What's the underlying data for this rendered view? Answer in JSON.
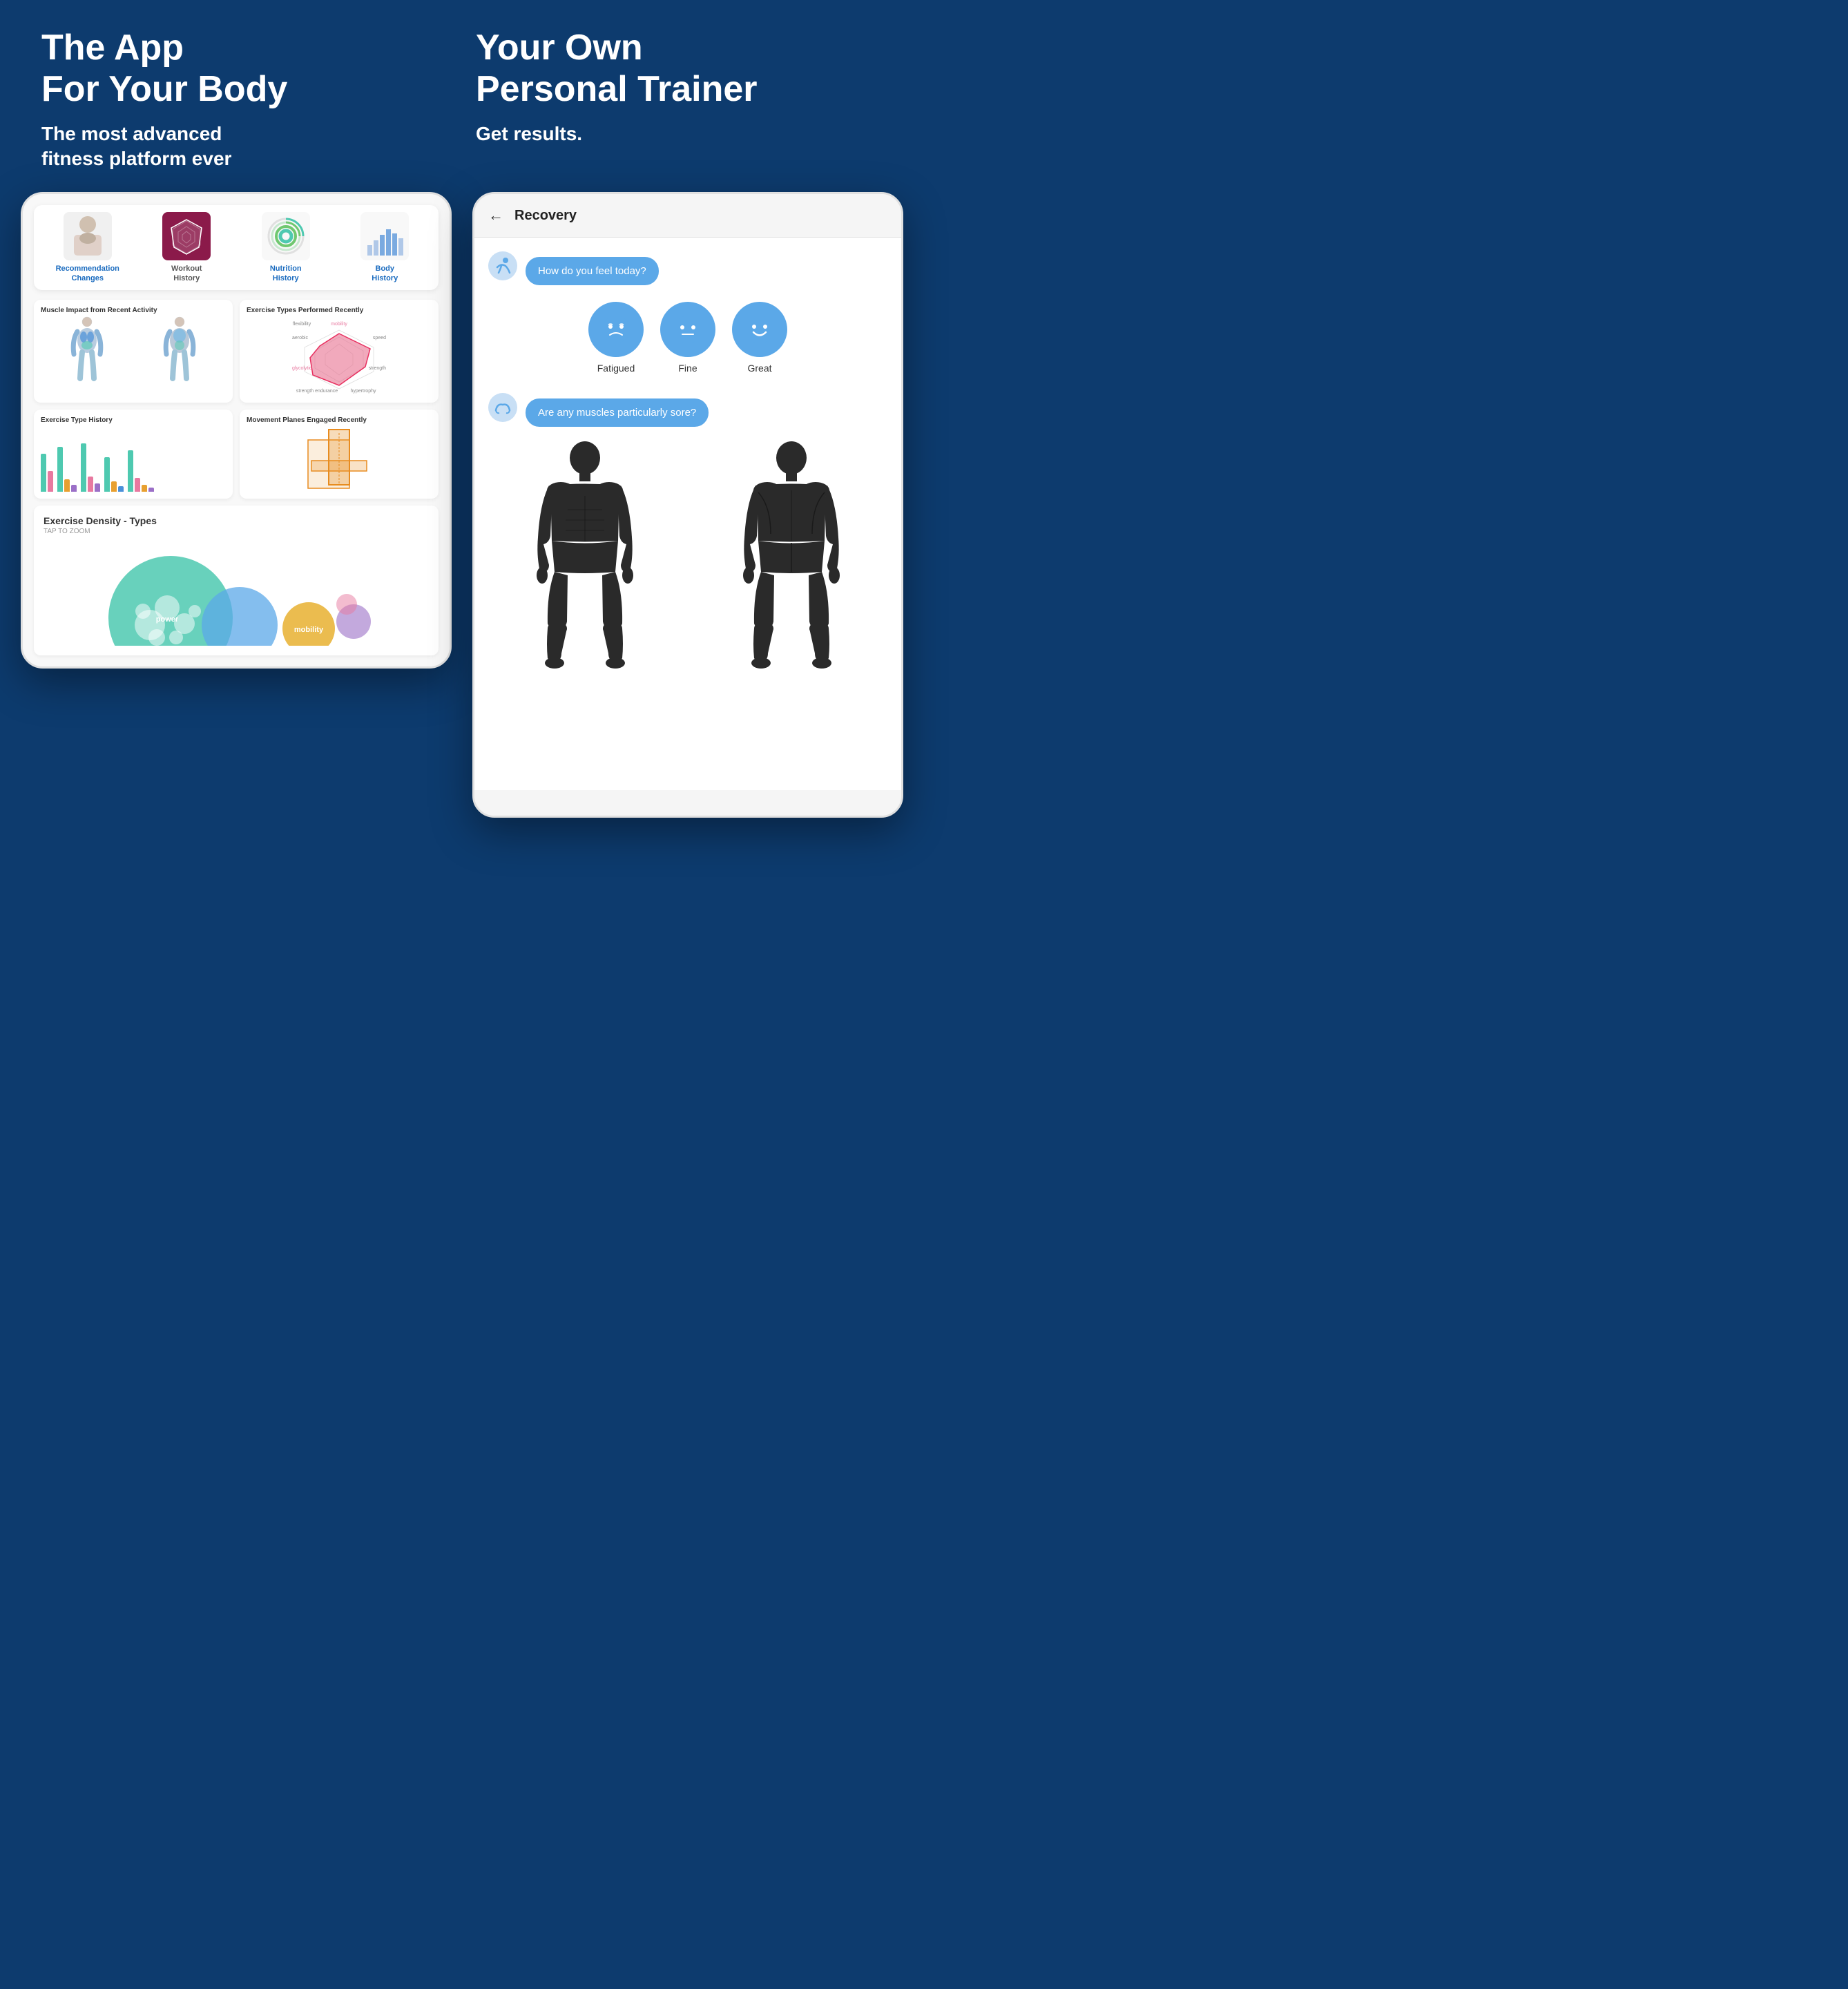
{
  "header": {
    "left_title": "The App\nFor Your Body",
    "left_subtitle": "The most advanced\nfitness platform ever",
    "right_title": "Your Own\nPersonal Trainer",
    "right_subtitle": "Get results.",
    "bg_color": "#0d3b6e"
  },
  "left_phone": {
    "tabs": [
      {
        "label": "Recommendation\nChanges",
        "type": "person",
        "active": false
      },
      {
        "label": "Workout\nHistory",
        "type": "workout",
        "active": true
      },
      {
        "label": "Nutrition\nHistory",
        "type": "nutrition",
        "active": false
      },
      {
        "label": "Body\nHistory",
        "type": "body",
        "active": false
      }
    ],
    "cards": [
      {
        "title": "Muscle Impact from Recent Activity"
      },
      {
        "title": "Exercise Types Performed Recently"
      },
      {
        "title": "Exercise Type History"
      },
      {
        "title": "Movement Planes Engaged Recently"
      }
    ],
    "density_title": "Exercise Density - Types",
    "density_subtitle": "TAP TO ZOOM",
    "bubble_labels": [
      "power",
      "mobility"
    ],
    "accent_color": "#4ec9b0"
  },
  "right_phone": {
    "back_icon": "←",
    "title": "Recovery",
    "question1": "How do you feel today?",
    "feelings": [
      {
        "label": "Fatigued"
      },
      {
        "label": "Fine"
      },
      {
        "label": "Great"
      }
    ],
    "question2": "Are any muscles particularly sore?",
    "accent_color": "#5ba8e8"
  },
  "radar_labels": [
    "mobility",
    "speed",
    "strength",
    "hypertrophy",
    "strength endurance",
    "glycolytic",
    "aerobic",
    "flexibility"
  ],
  "bars": {
    "teal": "#4ec9b0",
    "pink": "#e879a0",
    "orange": "#e8a030",
    "purple": "#9b6fc7",
    "blue": "#4a90d9"
  }
}
